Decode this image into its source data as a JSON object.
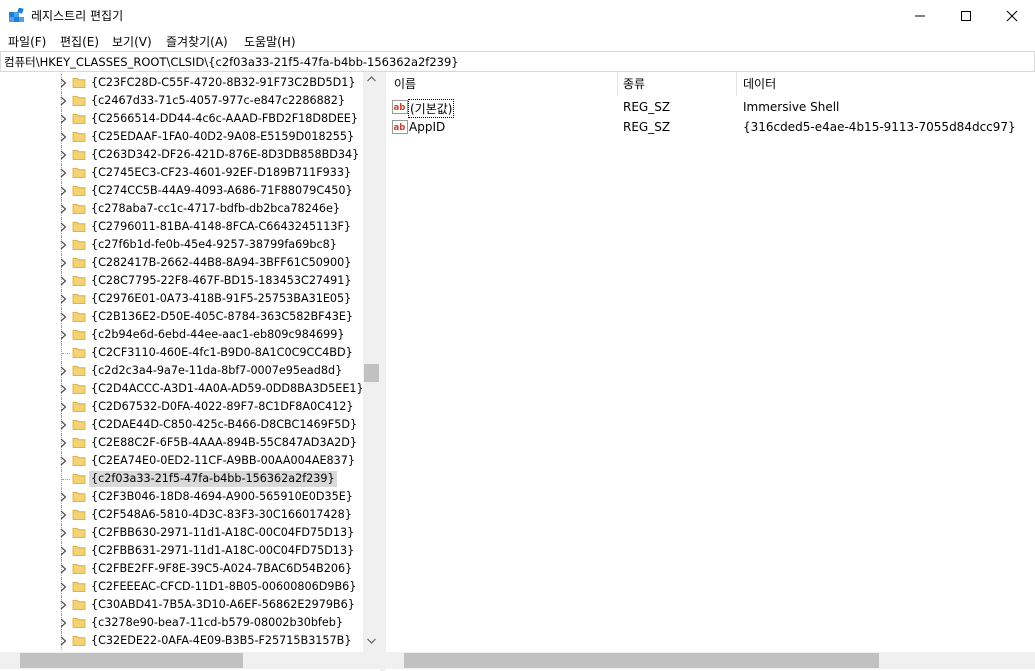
{
  "window": {
    "title": "레지스트리 편집기",
    "controls": [
      "minimize",
      "maximize",
      "close"
    ]
  },
  "menu": [
    {
      "label": "파일(F)"
    },
    {
      "label": "편집(E)"
    },
    {
      "label": "보기(V)"
    },
    {
      "label": "즐겨찾기(A)"
    },
    {
      "label": "도움말(H)"
    }
  ],
  "address": "컴퓨터\\HKEY_CLASSES_ROOT\\CLSID\\{c2f03a33-21f5-47fa-b4bb-156362a2f239}",
  "tree": {
    "items": [
      {
        "label": "{C23FC28D-C55F-4720-8B32-91F73C2BD5D1}",
        "expandable": true
      },
      {
        "label": "{c2467d33-71c5-4057-977c-e847c2286882}",
        "expandable": true
      },
      {
        "label": "{C2566514-DD44-4c6c-AAAD-FBD2F18D8DEE}",
        "expandable": true
      },
      {
        "label": "{C25EDAAF-1FA0-40D2-9A08-E5159D018255}",
        "expandable": true
      },
      {
        "label": "{C263D342-DF26-421D-876E-8D3DB858BD34}",
        "expandable": true
      },
      {
        "label": "{C2745EC3-CF23-4601-92EF-D189B711F933}",
        "expandable": true
      },
      {
        "label": "{C274CC5B-44A9-4093-A686-71F88079C450}",
        "expandable": true
      },
      {
        "label": "{c278aba7-cc1c-4717-bdfb-db2bca78246e}",
        "expandable": true
      },
      {
        "label": "{C2796011-81BA-4148-8FCA-C6643245113F}",
        "expandable": true
      },
      {
        "label": "{c27f6b1d-fe0b-45e4-9257-38799fa69bc8}",
        "expandable": true
      },
      {
        "label": "{C282417B-2662-44B8-8A94-3BFF61C50900}",
        "expandable": true
      },
      {
        "label": "{C28C7795-22F8-467F-BD15-183453C27491}",
        "expandable": true
      },
      {
        "label": "{C2976E01-0A73-418B-91F5-25753BA31E05}",
        "expandable": true
      },
      {
        "label": "{C2B136E2-D50E-405C-8784-363C582BF43E}",
        "expandable": true
      },
      {
        "label": "{c2b94e6d-6ebd-44ee-aac1-eb809c984699}",
        "expandable": true
      },
      {
        "label": "{C2CF3110-460E-4fc1-B9D0-8A1C0C9CC4BD}",
        "expandable": false
      },
      {
        "label": "{c2d2c3a4-9a7e-11da-8bf7-0007e95ead8d}",
        "expandable": true
      },
      {
        "label": "{C2D4ACCC-A3D1-4A0A-AD59-0DD8BA3D5EE1}",
        "expandable": true
      },
      {
        "label": "{C2D67532-D0FA-4022-89F7-8C1DF8A0C412}",
        "expandable": true
      },
      {
        "label": "{C2DAE44D-C850-425c-B466-D8CBC1469F5D}",
        "expandable": true
      },
      {
        "label": "{C2E88C2F-6F5B-4AAA-894B-55C847AD3A2D}",
        "expandable": true
      },
      {
        "label": "{C2EA74E0-0ED2-11CF-A9BB-00AA004AE837}",
        "expandable": true
      },
      {
        "label": "{c2f03a33-21f5-47fa-b4bb-156362a2f239}",
        "expandable": false,
        "selected": true
      },
      {
        "label": "{C2F3B046-18D8-4694-A900-565910E0D35E}",
        "expandable": true
      },
      {
        "label": "{C2F548A6-5810-4D3C-83F3-30C166017428}",
        "expandable": true
      },
      {
        "label": "{C2FBB630-2971-11d1-A18C-00C04FD75D13}",
        "expandable": true
      },
      {
        "label": "{C2FBB631-2971-11d1-A18C-00C04FD75D13}",
        "expandable": true
      },
      {
        "label": "{C2FBE2FF-9F8E-39C5-A024-7BAC6D54B206}",
        "expandable": true
      },
      {
        "label": "{C2FEEEAC-CFCD-11D1-8B05-00600806D9B6}",
        "expandable": true
      },
      {
        "label": "{C30ABD41-7B5A-3D10-A6EF-56862E2979B6}",
        "expandable": true
      },
      {
        "label": "{c3278e90-bea7-11cd-b579-08002b30bfeb}",
        "expandable": true
      },
      {
        "label": "{C32EDE22-0AFA-4E09-B3B5-F25715B3157B}",
        "expandable": true
      }
    ]
  },
  "list": {
    "columns": [
      "이름",
      "종류",
      "데이터"
    ],
    "rows": [
      {
        "name": "(기본값)",
        "type": "REG_SZ",
        "data": "Immersive Shell",
        "focused": true
      },
      {
        "name": "AppID",
        "type": "REG_SZ",
        "data": "{316cded5-e4ae-4b15-9113-7055d84dcc97}",
        "focused": false
      }
    ]
  },
  "colors": {
    "folder": "#f5d374",
    "folder_edge": "#d8b145",
    "selection": "#d9d9d9",
    "reg_icon_red": "#c9402d"
  },
  "scroll": {
    "tree_vertical_position": 0.52
  }
}
